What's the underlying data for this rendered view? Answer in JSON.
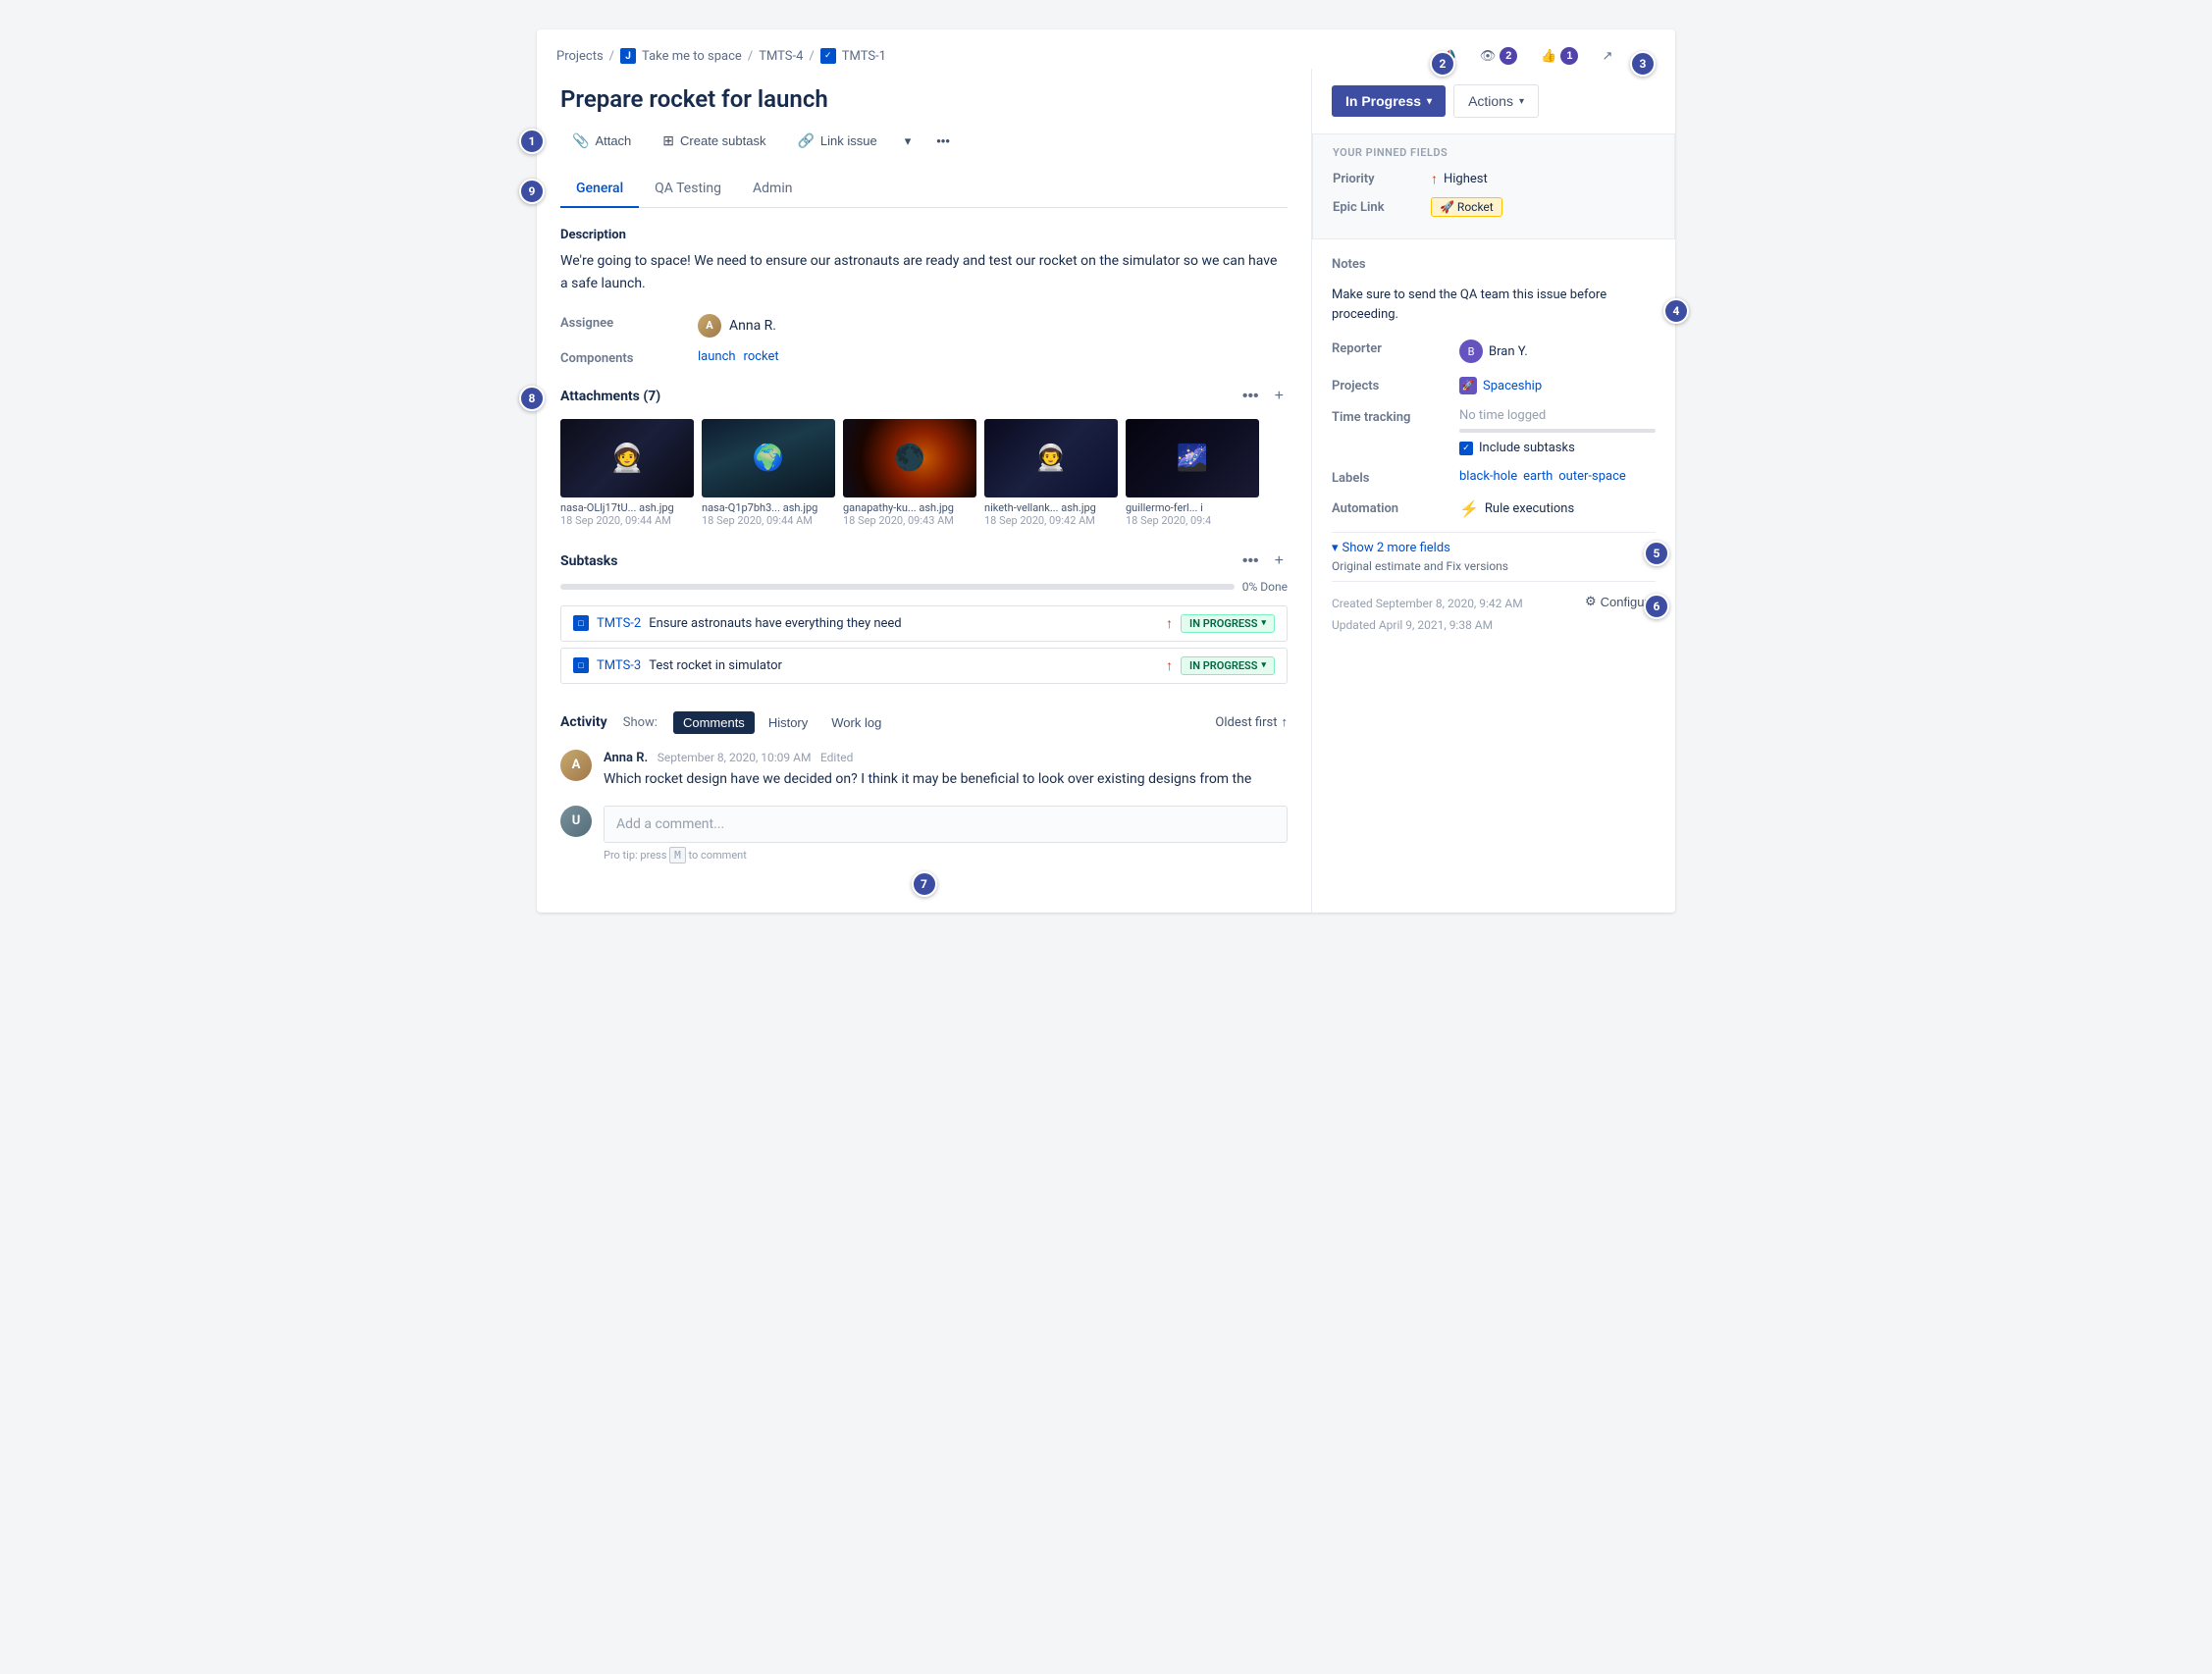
{
  "breadcrumb": {
    "projects": "Projects",
    "take_me_to_space": "Take me to space",
    "tmts4": "TMTS-4",
    "tmts1": "TMTS-1"
  },
  "top_actions": {
    "watch_label": "2",
    "like_label": "1"
  },
  "issue": {
    "title": "Prepare rocket for launch",
    "status": "In Progress",
    "actions": "Actions",
    "tabs": [
      "General",
      "QA Testing",
      "Admin"
    ],
    "active_tab": "General",
    "description_label": "Description",
    "description_text": "We're going to space! We need to ensure our astronauts are ready and test our rocket on the simulator so we can have a safe launch.",
    "assignee_label": "Assignee",
    "assignee_name": "Anna R.",
    "components_label": "Components",
    "components": [
      "launch",
      "rocket"
    ]
  },
  "toolbar": {
    "attach": "Attach",
    "create_subtask": "Create subtask",
    "link_issue": "Link issue"
  },
  "attachments": {
    "title": "Attachments",
    "count": 7,
    "items": [
      {
        "name": "nasa-OLlj17tU... ash.jpg",
        "date": "18 Sep 2020, 09:44 AM"
      },
      {
        "name": "nasa-Q1p7bh3... ash.jpg",
        "date": "18 Sep 2020, 09:44 AM"
      },
      {
        "name": "ganapathy-ku... ash.jpg",
        "date": "18 Sep 2020, 09:43 AM"
      },
      {
        "name": "niketh-vellank... ash.jpg",
        "date": "18 Sep 2020, 09:42 AM"
      },
      {
        "name": "guillermo-ferl... i",
        "date": "18 Sep 2020, 09:4"
      }
    ]
  },
  "subtasks": {
    "title": "Subtasks",
    "progress_pct": "0% Done",
    "progress_fill": "0",
    "items": [
      {
        "id": "TMTS-2",
        "name": "Ensure astronauts have everything they need",
        "status": "IN PROGRESS"
      },
      {
        "id": "TMTS-3",
        "name": "Test rocket in simulator",
        "status": "IN PROGRESS"
      }
    ]
  },
  "activity": {
    "title": "Activity",
    "show_label": "Show:",
    "tabs": [
      "Comments",
      "History",
      "Work log"
    ],
    "active_tab": "Comments",
    "sort_label": "Oldest first",
    "comment": {
      "author": "Anna R.",
      "date": "September 8, 2020, 10:09 AM",
      "edited": "Edited",
      "text": "Which rocket design have we decided on? I think it may be beneficial to look over existing designs from the"
    },
    "add_comment_placeholder": "Add a comment...",
    "pro_tip": "Pro tip: press",
    "pro_tip_key": "M",
    "pro_tip_suffix": "to comment"
  },
  "right_panel": {
    "pinned_label": "YOUR PINNED FIELDS",
    "priority_label": "Priority",
    "priority_value": "Highest",
    "epic_label": "Epic Link",
    "epic_value": "🚀 Rocket",
    "notes_label": "Notes",
    "notes_value": "Make sure to send the QA team this issue before proceeding.",
    "reporter_label": "Reporter",
    "reporter_name": "Bran Y.",
    "projects_label": "Projects",
    "projects_value": "Spaceship",
    "time_tracking_label": "Time tracking",
    "time_no_logged": "No time logged",
    "include_subtasks": "Include subtasks",
    "labels_label": "Labels",
    "labels": [
      "black-hole",
      "earth",
      "outer-space"
    ],
    "automation_label": "Automation",
    "automation_value": "Rule executions",
    "show_more_label": "Show 2 more fields",
    "show_more_sub": "Original estimate and Fix versions",
    "created": "Created September 8, 2020, 9:42 AM",
    "updated": "Updated April 9, 2021, 9:38 AM",
    "configure": "Configure"
  }
}
